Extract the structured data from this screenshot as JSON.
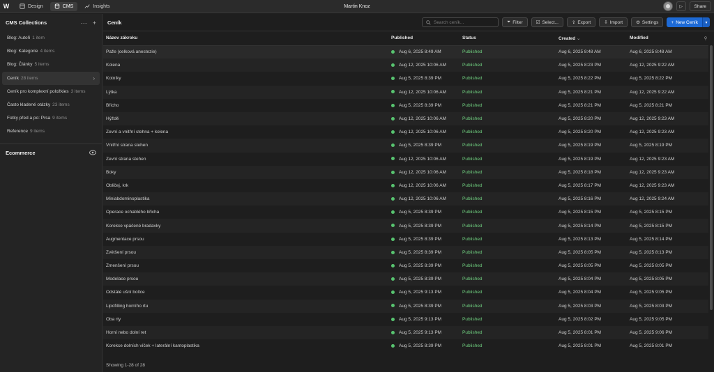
{
  "topbar": {
    "logo": "W",
    "nav": [
      {
        "label": "Design",
        "icon": "design-icon"
      },
      {
        "label": "CMS",
        "icon": "database-icon"
      },
      {
        "label": "Insights",
        "icon": "chart-icon"
      }
    ],
    "user_name": "Martin Knoz",
    "share_label": "Share"
  },
  "sidebar": {
    "title": "CMS Collections",
    "items": [
      {
        "name": "Blog: Autoři",
        "count": "1 item"
      },
      {
        "name": "Blog: Kategorie",
        "count": "4 items"
      },
      {
        "name": "Blog: Články",
        "count": "5 items"
      },
      {
        "name": "Ceník",
        "count": "28 items"
      },
      {
        "name": "Ceník pro komplexní položkies",
        "count": "3 items"
      },
      {
        "name": "Často kladené otázky",
        "count": "23 items"
      },
      {
        "name": "Fotky před a po: Prsa",
        "count": "9 items"
      },
      {
        "name": "Reference",
        "count": "9 items"
      }
    ],
    "ecommerce_label": "Ecommerce"
  },
  "main": {
    "title": "Ceník",
    "search_placeholder": "Search ceník...",
    "buttons": {
      "filter": "Filter",
      "select": "Select...",
      "export": "Export",
      "import": "Import",
      "settings": "Settings",
      "new": "New Ceník"
    },
    "columns": [
      "Název zákroku",
      "Published",
      "Status",
      "Created",
      "Modified"
    ],
    "rows": [
      [
        "Paže (celková anestezie)",
        "Aug 6, 2025 8:49 AM",
        "Published",
        "Aug 6, 2025 8:48 AM",
        "Aug 6, 2025 8:48 AM"
      ],
      [
        "Kolena",
        "Aug 12, 2025 10:06 AM",
        "Published",
        "Aug 5, 2025 8:23 PM",
        "Aug 12, 2025 9:22 AM"
      ],
      [
        "Kotníky",
        "Aug 5, 2025 8:39 PM",
        "Published",
        "Aug 5, 2025 8:22 PM",
        "Aug 5, 2025 8:22 PM"
      ],
      [
        "Lýtka",
        "Aug 12, 2025 10:06 AM",
        "Published",
        "Aug 5, 2025 8:21 PM",
        "Aug 12, 2025 9:22 AM"
      ],
      [
        "Břicho",
        "Aug 5, 2025 8:39 PM",
        "Published",
        "Aug 5, 2025 8:21 PM",
        "Aug 5, 2025 8:21 PM"
      ],
      [
        "Hýždě",
        "Aug 12, 2025 10:06 AM",
        "Published",
        "Aug 5, 2025 8:20 PM",
        "Aug 12, 2025 9:23 AM"
      ],
      [
        "Zevní a vnitřní stehna + kolena",
        "Aug 12, 2025 10:06 AM",
        "Published",
        "Aug 5, 2025 8:20 PM",
        "Aug 12, 2025 9:23 AM"
      ],
      [
        "Vnitřní strana stehen",
        "Aug 5, 2025 8:39 PM",
        "Published",
        "Aug 5, 2025 8:19 PM",
        "Aug 5, 2025 8:19 PM"
      ],
      [
        "Zevní strana stehen",
        "Aug 12, 2025 10:06 AM",
        "Published",
        "Aug 5, 2025 8:19 PM",
        "Aug 12, 2025 9:23 AM"
      ],
      [
        "Boky",
        "Aug 12, 2025 10:06 AM",
        "Published",
        "Aug 5, 2025 8:18 PM",
        "Aug 12, 2025 9:23 AM"
      ],
      [
        "Obličej, krk",
        "Aug 12, 2025 10:06 AM",
        "Published",
        "Aug 5, 2025 8:17 PM",
        "Aug 12, 2025 9:23 AM"
      ],
      [
        "Miniabdominoplastika",
        "Aug 12, 2025 10:06 AM",
        "Published",
        "Aug 5, 2025 8:16 PM",
        "Aug 12, 2025 9:24 AM"
      ],
      [
        "Operace ochablého břicha",
        "Aug 5, 2025 8:39 PM",
        "Published",
        "Aug 5, 2025 8:15 PM",
        "Aug 5, 2025 8:15 PM"
      ],
      [
        "Korekce vpáčené bradavky",
        "Aug 5, 2025 8:39 PM",
        "Published",
        "Aug 5, 2025 8:14 PM",
        "Aug 5, 2025 8:15 PM"
      ],
      [
        "Augmentace prsou",
        "Aug 5, 2025 8:39 PM",
        "Published",
        "Aug 5, 2025 8:13 PM",
        "Aug 5, 2025 8:14 PM"
      ],
      [
        "Zvětšení prsou",
        "Aug 5, 2025 8:39 PM",
        "Published",
        "Aug 5, 2025 8:05 PM",
        "Aug 5, 2025 8:13 PM"
      ],
      [
        "Zmenšení prsou",
        "Aug 5, 2025 8:39 PM",
        "Published",
        "Aug 5, 2025 8:05 PM",
        "Aug 5, 2025 8:05 PM"
      ],
      [
        "Modelace prsou",
        "Aug 5, 2025 8:39 PM",
        "Published",
        "Aug 5, 2025 8:04 PM",
        "Aug 5, 2025 8:05 PM"
      ],
      [
        "Odstálé ušní boltce",
        "Aug 5, 2025 9:13 PM",
        "Published",
        "Aug 5, 2025 8:04 PM",
        "Aug 5, 2025 9:05 PM"
      ],
      [
        "Lipofilling horního rtu",
        "Aug 5, 2025 8:39 PM",
        "Published",
        "Aug 5, 2025 8:03 PM",
        "Aug 5, 2025 8:03 PM"
      ],
      [
        "Oba rty",
        "Aug 5, 2025 9:13 PM",
        "Published",
        "Aug 5, 2025 8:02 PM",
        "Aug 5, 2025 9:05 PM"
      ],
      [
        "Horní nebo dolní ret",
        "Aug 5, 2025 9:13 PM",
        "Published",
        "Aug 5, 2025 8:01 PM",
        "Aug 5, 2025 9:06 PM"
      ],
      [
        "Korekce dolních víček + laterální kantoplastika",
        "Aug 5, 2025 8:39 PM",
        "Published",
        "Aug 5, 2025 8:01 PM",
        "Aug 5, 2025 8:01 PM"
      ]
    ],
    "footer": "Showing 1-28 of 28"
  },
  "colors": {
    "accent": "#1d6ad6",
    "status_green": "#6fcf7f",
    "background": "#1e1e1e"
  }
}
